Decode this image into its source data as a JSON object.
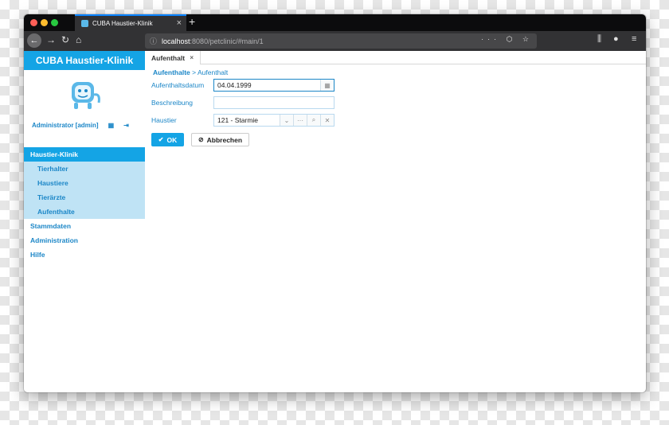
{
  "browser": {
    "tab_title": "CUBA Haustier-Klinik",
    "new_tab": "+",
    "url_host": "localhost",
    "url_rest": ":8080/petclinic/#main/1"
  },
  "app": {
    "title": "CUBA Haustier-Klinik",
    "user": "Administrator [admin]"
  },
  "menu": {
    "haustier_klinik": "Haustier-Klinik",
    "sub": [
      "Tierhalter",
      "Haustiere",
      "Tierärzte",
      "Aufenthalte"
    ],
    "stammdaten": "Stammdaten",
    "administration": "Administration",
    "hilfe": "Hilfe"
  },
  "workspace": {
    "tab": "Aufenthalt",
    "breadcrumb_parent": "Aufenthalte",
    "breadcrumb_current": "> Aufenthalt"
  },
  "form": {
    "date_label": "Aufenthaltsdatum",
    "date_value": "04.04.1999",
    "desc_label": "Beschreibung",
    "desc_value": "",
    "pet_label": "Haustier",
    "pet_value": "121 - Starmie"
  },
  "actions": {
    "ok": "OK",
    "cancel": "Abbrechen"
  },
  "colors": {
    "accent": "#14a4e5",
    "link": "#1b86c7",
    "submenu_bg": "#bfe3f5"
  }
}
